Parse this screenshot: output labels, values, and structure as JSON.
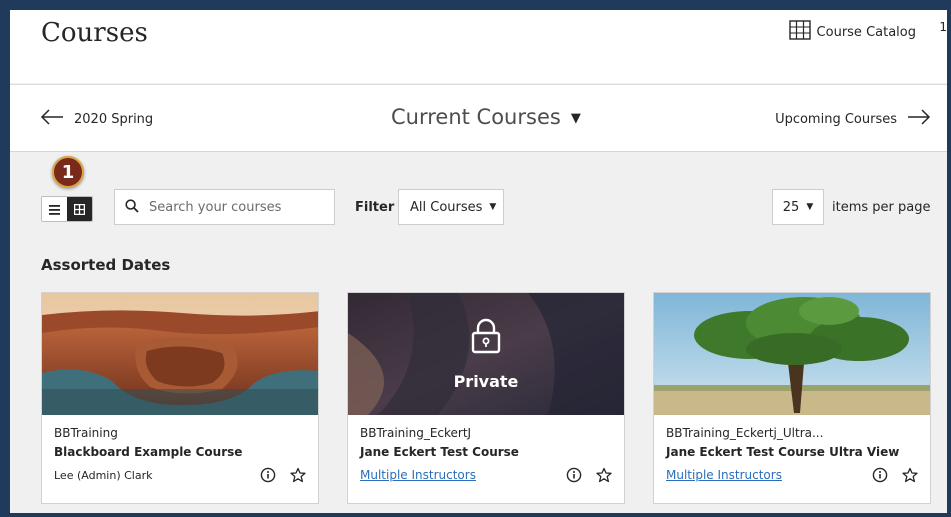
{
  "header": {
    "title": "Courses",
    "catalog_label": "Course Catalog",
    "edge_digit": "1"
  },
  "term_nav": {
    "previous": "2020 Spring",
    "current": "Current Courses",
    "next": "Upcoming Courses"
  },
  "callout": {
    "number": "1"
  },
  "toolbar": {
    "search_placeholder": "Search your courses",
    "filter_label": "Filter",
    "filter_value": "All Courses",
    "per_page_value": "25",
    "per_page_label": "items per page"
  },
  "section": {
    "heading": "Assorted Dates"
  },
  "courses": [
    {
      "course_id": "BBTraining",
      "name": "Blackboard Example Course",
      "instructor": "Lee (Admin) Clark"
    },
    {
      "course_id": "BBTraining_EckertJ",
      "name": "Jane Eckert Test Course",
      "instructor": "Multiple Instructors",
      "private_label": "Private"
    },
    {
      "course_id": "BBTraining_Eckertj_Ultra...",
      "name": "Jane Eckert Test Course Ultra View",
      "instructor": "Multiple Instructors"
    }
  ],
  "colors": {
    "link": "#2a6ebb",
    "callout_fill": "#7a2a1a",
    "callout_ring": "#d9a441",
    "frame_border": "#1f3a5a"
  }
}
